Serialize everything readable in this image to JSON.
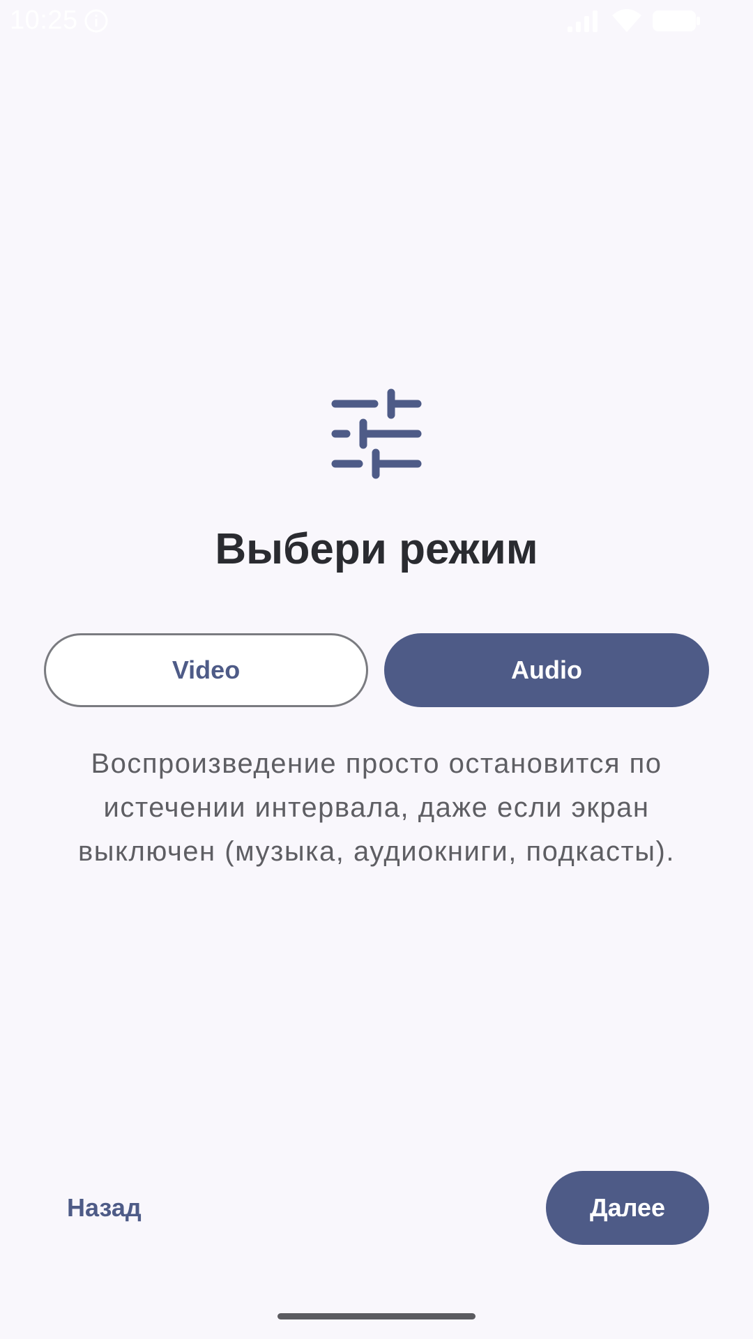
{
  "status_bar": {
    "time": "10:25",
    "icons": [
      "info-icon",
      "signal-icon",
      "wifi-icon",
      "battery-icon"
    ]
  },
  "main": {
    "icon": "tune-sliders-icon",
    "title": "Выбери режим",
    "modes": [
      {
        "label": "Video",
        "selected": false
      },
      {
        "label": "Audio",
        "selected": true
      }
    ],
    "description": "Воспроизведение просто остановится по истечении интервала, даже если экран выключен (музыка, аудиокниги, подкасты)."
  },
  "navigation": {
    "back_label": "Назад",
    "next_label": "Далее"
  },
  "colors": {
    "background": "#f9f7fc",
    "accent": "#4e5b87",
    "title": "#2a2b30",
    "body_text": "#5e5e63"
  }
}
